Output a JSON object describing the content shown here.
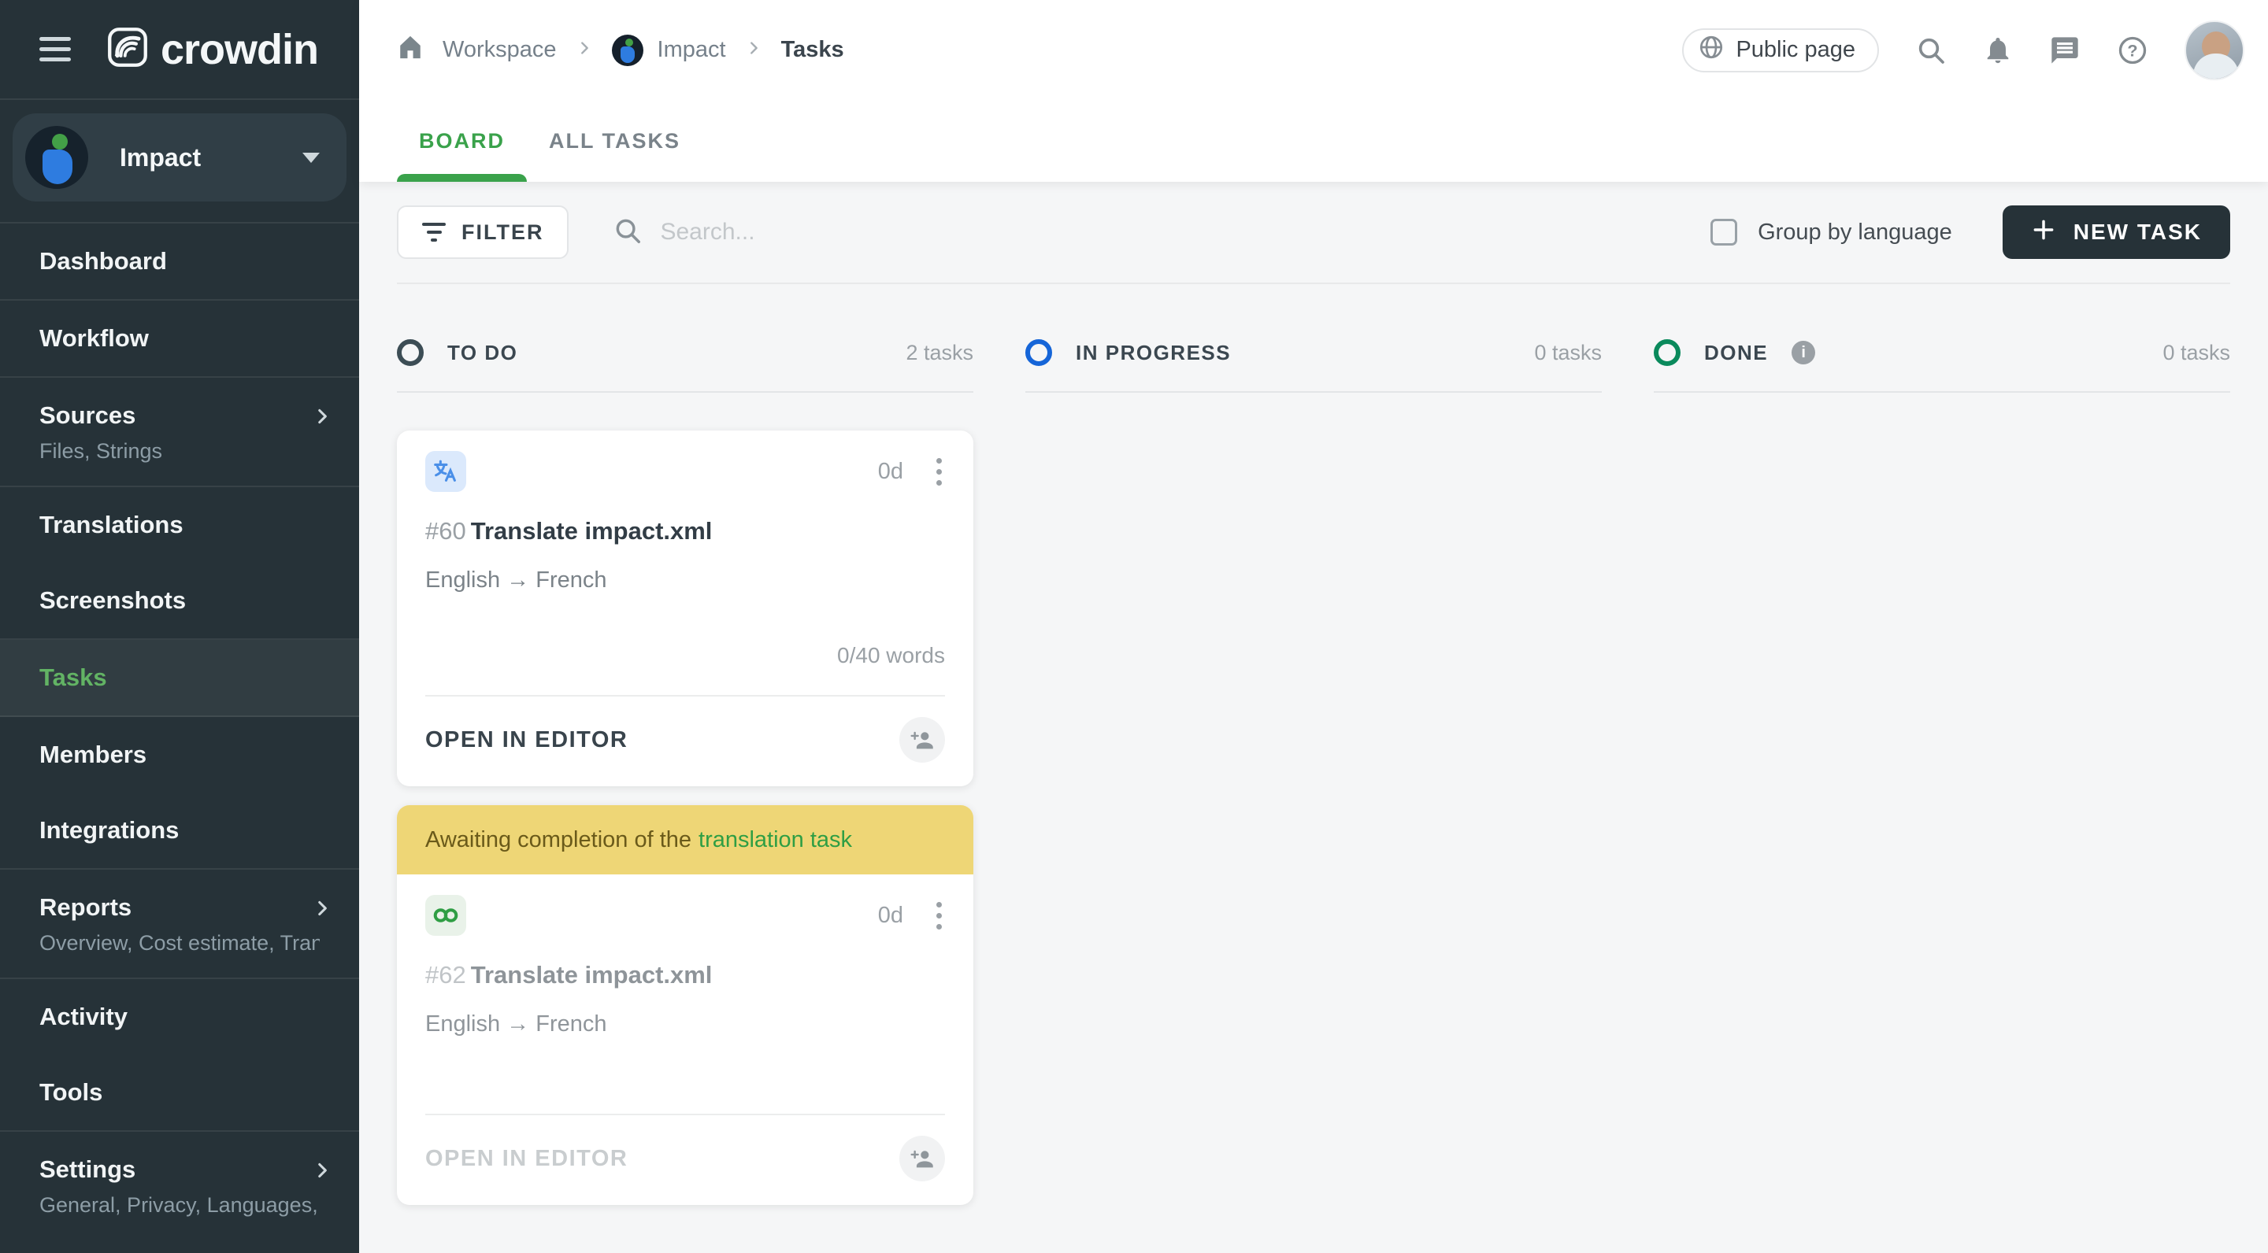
{
  "app": {
    "name": "crowdin"
  },
  "colors": {
    "accent_green": "#3aa24b",
    "sidebar_active_green": "#62b364",
    "todo_ring": "#3c4d55",
    "in_progress_ring": "#1565d8",
    "done_ring": "#0a8a5c",
    "banner_bg": "#eed676",
    "banner_text": "#6a5a1a",
    "banner_link_green": "#2f9e44",
    "new_task_bg": "#263238"
  },
  "sidebar": {
    "project_name": "Impact",
    "items": [
      {
        "label": "Dashboard"
      },
      {
        "label": "Workflow"
      },
      {
        "label": "Sources",
        "subtitle": "Files, Strings"
      },
      {
        "label": "Translations"
      },
      {
        "label": "Screenshots"
      },
      {
        "label": "Tasks"
      },
      {
        "label": "Members"
      },
      {
        "label": "Integrations"
      },
      {
        "label": "Reports",
        "subtitle": "Overview, Cost estimate, Transl…"
      },
      {
        "label": "Activity"
      },
      {
        "label": "Tools"
      },
      {
        "label": "Settings",
        "subtitle": "General, Privacy, Languages, Q…"
      }
    ]
  },
  "header": {
    "breadcrumb": {
      "items": [
        "Workspace",
        "Impact",
        "Tasks"
      ]
    },
    "public_page": "Public page"
  },
  "tabs": [
    {
      "label": "BOARD"
    },
    {
      "label": "ALL TASKS"
    }
  ],
  "toolbar": {
    "filter": "FILTER",
    "search_placeholder": "Search...",
    "group_by": "Group by language",
    "new_task": "NEW TASK"
  },
  "board": {
    "columns": [
      {
        "title": "TO DO",
        "count": "2 tasks",
        "ring": "#3c4d55"
      },
      {
        "title": "IN PROGRESS",
        "count": "0 tasks",
        "ring": "#1565d8"
      },
      {
        "title": "DONE",
        "count": "0 tasks",
        "ring": "#0a8a5c"
      }
    ],
    "cards": [
      {
        "id": "#60",
        "name": "Translate impact.xml",
        "languages": "English → French",
        "duration": "0d",
        "words": "0/40 words",
        "action": "OPEN IN EDITOR"
      },
      {
        "id": "#62",
        "name": "Translate impact.xml",
        "languages": "English → French",
        "duration": "0d",
        "action": "OPEN IN EDITOR",
        "banner_text": "Awaiting completion of the",
        "banner_link": "translation task"
      }
    ]
  }
}
